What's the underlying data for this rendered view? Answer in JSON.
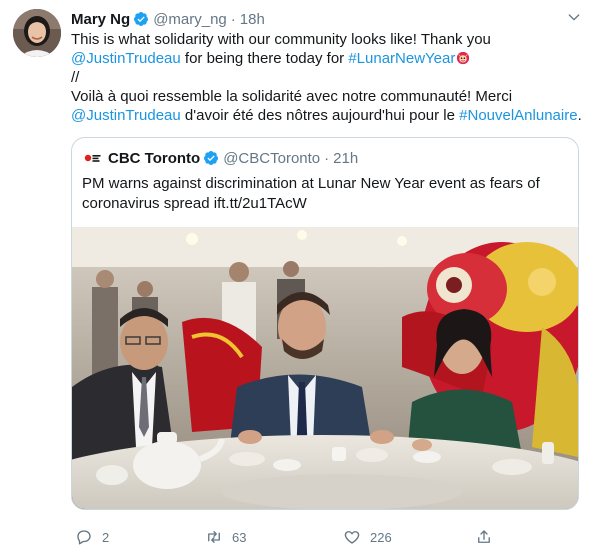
{
  "author": {
    "name": "Mary Ng",
    "handle": "@mary_ng",
    "separator": "·",
    "time": "18h"
  },
  "tweet": {
    "line1": "This is what solidarity with our community looks like! Thank you",
    "line2_mention": "@JustinTrudeau",
    "line2_middle": " for being there today for ",
    "line2_hashtag": "#LunarNewYear",
    "line3": "//",
    "line4": "Voilà à quoi ressemble la solidarité avec notre communauté! Merci",
    "line5_mention": "@JustinTrudeau",
    "line5_middle": " d'avoir été des nôtres aujourd'hui pour le ",
    "line5_hashtag": "#NouvelAnlunaire",
    "line5_end": ".",
    "emoji": "lion-dance-emoji"
  },
  "quoted": {
    "name": "CBC Toronto",
    "handle": "@CBCToronto",
    "separator": "·",
    "time": "21h",
    "line1": "PM warns against discrimination at Lunar New Year event as fears of",
    "line2": "coronavirus spread ift.tt/2u1TAcW",
    "photo": "lunar-new-year-event-photo"
  },
  "actions": {
    "replies": "2",
    "retweets": "63",
    "likes": "226"
  },
  "colors": {
    "link": "#1b95e0",
    "muted": "#657786",
    "text": "#14171a",
    "border": "#ccd6dd",
    "verified": "#1da1f2"
  }
}
